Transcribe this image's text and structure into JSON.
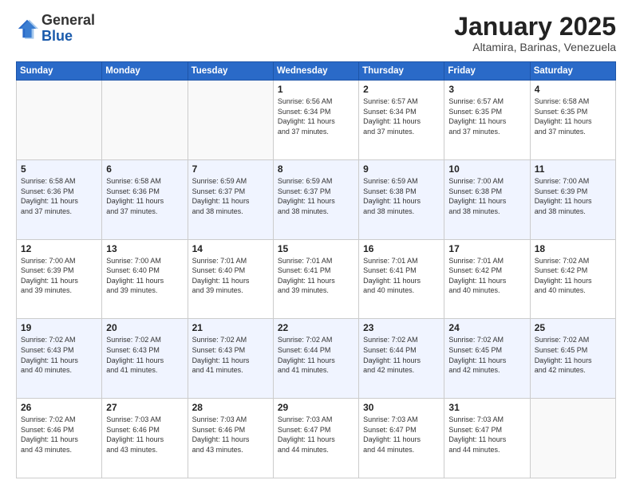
{
  "header": {
    "logo_general": "General",
    "logo_blue": "Blue",
    "title": "January 2025",
    "location": "Altamira, Barinas, Venezuela"
  },
  "days_of_week": [
    "Sunday",
    "Monday",
    "Tuesday",
    "Wednesday",
    "Thursday",
    "Friday",
    "Saturday"
  ],
  "weeks": [
    [
      {
        "day": "",
        "info": ""
      },
      {
        "day": "",
        "info": ""
      },
      {
        "day": "",
        "info": ""
      },
      {
        "day": "1",
        "info": "Sunrise: 6:56 AM\nSunset: 6:34 PM\nDaylight: 11 hours\nand 37 minutes."
      },
      {
        "day": "2",
        "info": "Sunrise: 6:57 AM\nSunset: 6:34 PM\nDaylight: 11 hours\nand 37 minutes."
      },
      {
        "day": "3",
        "info": "Sunrise: 6:57 AM\nSunset: 6:35 PM\nDaylight: 11 hours\nand 37 minutes."
      },
      {
        "day": "4",
        "info": "Sunrise: 6:58 AM\nSunset: 6:35 PM\nDaylight: 11 hours\nand 37 minutes."
      }
    ],
    [
      {
        "day": "5",
        "info": "Sunrise: 6:58 AM\nSunset: 6:36 PM\nDaylight: 11 hours\nand 37 minutes."
      },
      {
        "day": "6",
        "info": "Sunrise: 6:58 AM\nSunset: 6:36 PM\nDaylight: 11 hours\nand 37 minutes."
      },
      {
        "day": "7",
        "info": "Sunrise: 6:59 AM\nSunset: 6:37 PM\nDaylight: 11 hours\nand 38 minutes."
      },
      {
        "day": "8",
        "info": "Sunrise: 6:59 AM\nSunset: 6:37 PM\nDaylight: 11 hours\nand 38 minutes."
      },
      {
        "day": "9",
        "info": "Sunrise: 6:59 AM\nSunset: 6:38 PM\nDaylight: 11 hours\nand 38 minutes."
      },
      {
        "day": "10",
        "info": "Sunrise: 7:00 AM\nSunset: 6:38 PM\nDaylight: 11 hours\nand 38 minutes."
      },
      {
        "day": "11",
        "info": "Sunrise: 7:00 AM\nSunset: 6:39 PM\nDaylight: 11 hours\nand 38 minutes."
      }
    ],
    [
      {
        "day": "12",
        "info": "Sunrise: 7:00 AM\nSunset: 6:39 PM\nDaylight: 11 hours\nand 39 minutes."
      },
      {
        "day": "13",
        "info": "Sunrise: 7:00 AM\nSunset: 6:40 PM\nDaylight: 11 hours\nand 39 minutes."
      },
      {
        "day": "14",
        "info": "Sunrise: 7:01 AM\nSunset: 6:40 PM\nDaylight: 11 hours\nand 39 minutes."
      },
      {
        "day": "15",
        "info": "Sunrise: 7:01 AM\nSunset: 6:41 PM\nDaylight: 11 hours\nand 39 minutes."
      },
      {
        "day": "16",
        "info": "Sunrise: 7:01 AM\nSunset: 6:41 PM\nDaylight: 11 hours\nand 40 minutes."
      },
      {
        "day": "17",
        "info": "Sunrise: 7:01 AM\nSunset: 6:42 PM\nDaylight: 11 hours\nand 40 minutes."
      },
      {
        "day": "18",
        "info": "Sunrise: 7:02 AM\nSunset: 6:42 PM\nDaylight: 11 hours\nand 40 minutes."
      }
    ],
    [
      {
        "day": "19",
        "info": "Sunrise: 7:02 AM\nSunset: 6:43 PM\nDaylight: 11 hours\nand 40 minutes."
      },
      {
        "day": "20",
        "info": "Sunrise: 7:02 AM\nSunset: 6:43 PM\nDaylight: 11 hours\nand 41 minutes."
      },
      {
        "day": "21",
        "info": "Sunrise: 7:02 AM\nSunset: 6:43 PM\nDaylight: 11 hours\nand 41 minutes."
      },
      {
        "day": "22",
        "info": "Sunrise: 7:02 AM\nSunset: 6:44 PM\nDaylight: 11 hours\nand 41 minutes."
      },
      {
        "day": "23",
        "info": "Sunrise: 7:02 AM\nSunset: 6:44 PM\nDaylight: 11 hours\nand 42 minutes."
      },
      {
        "day": "24",
        "info": "Sunrise: 7:02 AM\nSunset: 6:45 PM\nDaylight: 11 hours\nand 42 minutes."
      },
      {
        "day": "25",
        "info": "Sunrise: 7:02 AM\nSunset: 6:45 PM\nDaylight: 11 hours\nand 42 minutes."
      }
    ],
    [
      {
        "day": "26",
        "info": "Sunrise: 7:02 AM\nSunset: 6:46 PM\nDaylight: 11 hours\nand 43 minutes."
      },
      {
        "day": "27",
        "info": "Sunrise: 7:03 AM\nSunset: 6:46 PM\nDaylight: 11 hours\nand 43 minutes."
      },
      {
        "day": "28",
        "info": "Sunrise: 7:03 AM\nSunset: 6:46 PM\nDaylight: 11 hours\nand 43 minutes."
      },
      {
        "day": "29",
        "info": "Sunrise: 7:03 AM\nSunset: 6:47 PM\nDaylight: 11 hours\nand 44 minutes."
      },
      {
        "day": "30",
        "info": "Sunrise: 7:03 AM\nSunset: 6:47 PM\nDaylight: 11 hours\nand 44 minutes."
      },
      {
        "day": "31",
        "info": "Sunrise: 7:03 AM\nSunset: 6:47 PM\nDaylight: 11 hours\nand 44 minutes."
      },
      {
        "day": "",
        "info": ""
      }
    ]
  ]
}
